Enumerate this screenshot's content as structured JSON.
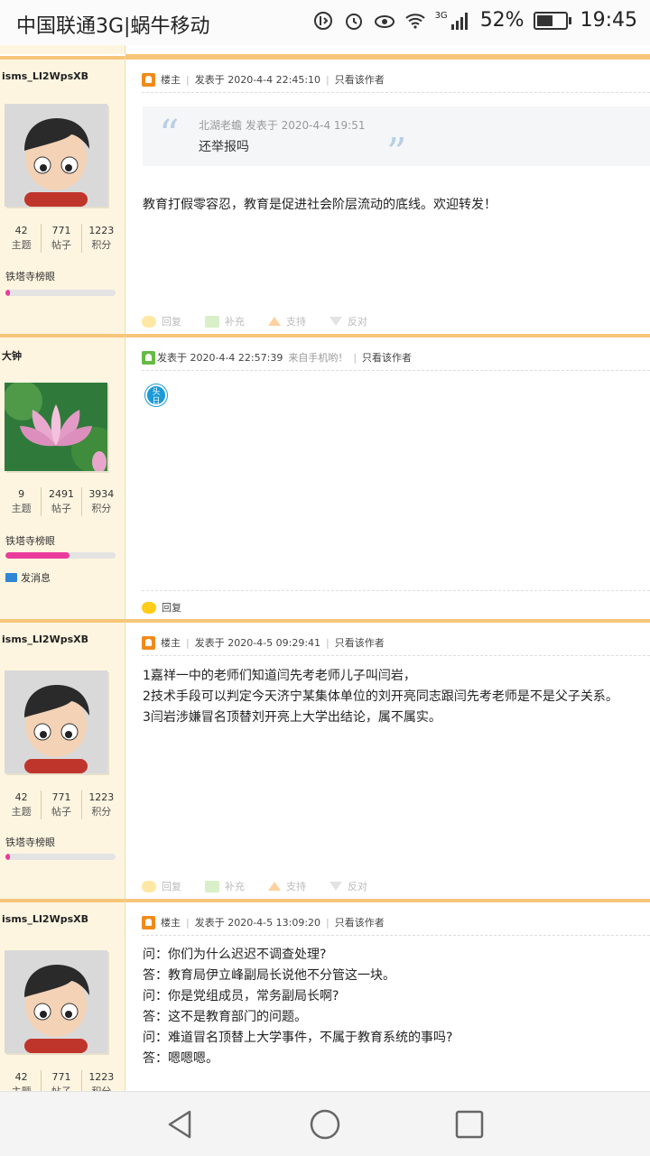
{
  "status_bar": {
    "carrier": "中国联通3G|蜗牛移动",
    "network": "3G",
    "battery": "52%",
    "time": "19:45"
  },
  "posts": [
    {
      "username": "isms_LI2WpsXB",
      "stats": [
        {
          "value": "42",
          "label": "主题"
        },
        {
          "value": "771",
          "label": "帖子"
        },
        {
          "value": "1223",
          "label": "积分"
        }
      ],
      "rank": "铁塔寺榜眼",
      "rank_progress": 0.04,
      "owner_label": "楼主",
      "posted": "发表于 2020-4-4 22:45:10",
      "only_author": "只看该作者",
      "quote": {
        "meta": "北湖老蟾 发表于 2020-4-4 19:51",
        "text": "还举报吗"
      },
      "lines": [
        "教育打假零容忍，教育是促进社会阶层流动的底线。欢迎转发！"
      ],
      "actions": [
        "回复",
        "补充",
        "支持",
        "反对"
      ]
    },
    {
      "username": "大钟",
      "stats": [
        {
          "value": "9",
          "label": "主题"
        },
        {
          "value": "2491",
          "label": "帖子"
        },
        {
          "value": "3934",
          "label": "积分"
        }
      ],
      "rank": "铁塔寺榜眼",
      "rank_progress": 0.58,
      "send_message": "发消息",
      "posted": "发表于 2020-4-4 22:57:39",
      "from_mobile": "来自手机哟！",
      "only_author": "只看该作者",
      "emoji_text": "头\n日",
      "actions": [
        "回复"
      ]
    },
    {
      "username": "isms_LI2WpsXB",
      "stats": [
        {
          "value": "42",
          "label": "主题"
        },
        {
          "value": "771",
          "label": "帖子"
        },
        {
          "value": "1223",
          "label": "积分"
        }
      ],
      "rank": "铁塔寺榜眼",
      "rank_progress": 0.04,
      "owner_label": "楼主",
      "posted": "发表于 2020-4-5 09:29:41",
      "only_author": "只看该作者",
      "lines": [
        "1嘉祥一中的老师们知道闫先考老师儿子叫闫岩，",
        "2技术手段可以判定今天济宁某集体单位的刘开亮同志跟闫先考老师是不是父子关系。",
        "3闫岩涉嫌冒名顶替刘开亮上大学出结论，属不属实。"
      ],
      "actions": [
        "回复",
        "补充",
        "支持",
        "反对"
      ]
    },
    {
      "username": "isms_LI2WpsXB",
      "stats": [
        {
          "value": "42",
          "label": "主题"
        },
        {
          "value": "771",
          "label": "帖子"
        },
        {
          "value": "1223",
          "label": "积分"
        }
      ],
      "owner_label": "楼主",
      "posted": "发表于 2020-4-5 13:09:20",
      "only_author": "只看该作者",
      "lines": [
        "问：你们为什么迟迟不调查处理?",
        "答：教育局伊立峰副局长说他不分管这一块。",
        "问：你是党组成员，常务副局长啊?",
        "答：这不是教育部门的问题。",
        "问：难道冒名顶替上大学事件，不属于教育系统的事吗?",
        "答：嗯嗯嗯。"
      ]
    }
  ]
}
